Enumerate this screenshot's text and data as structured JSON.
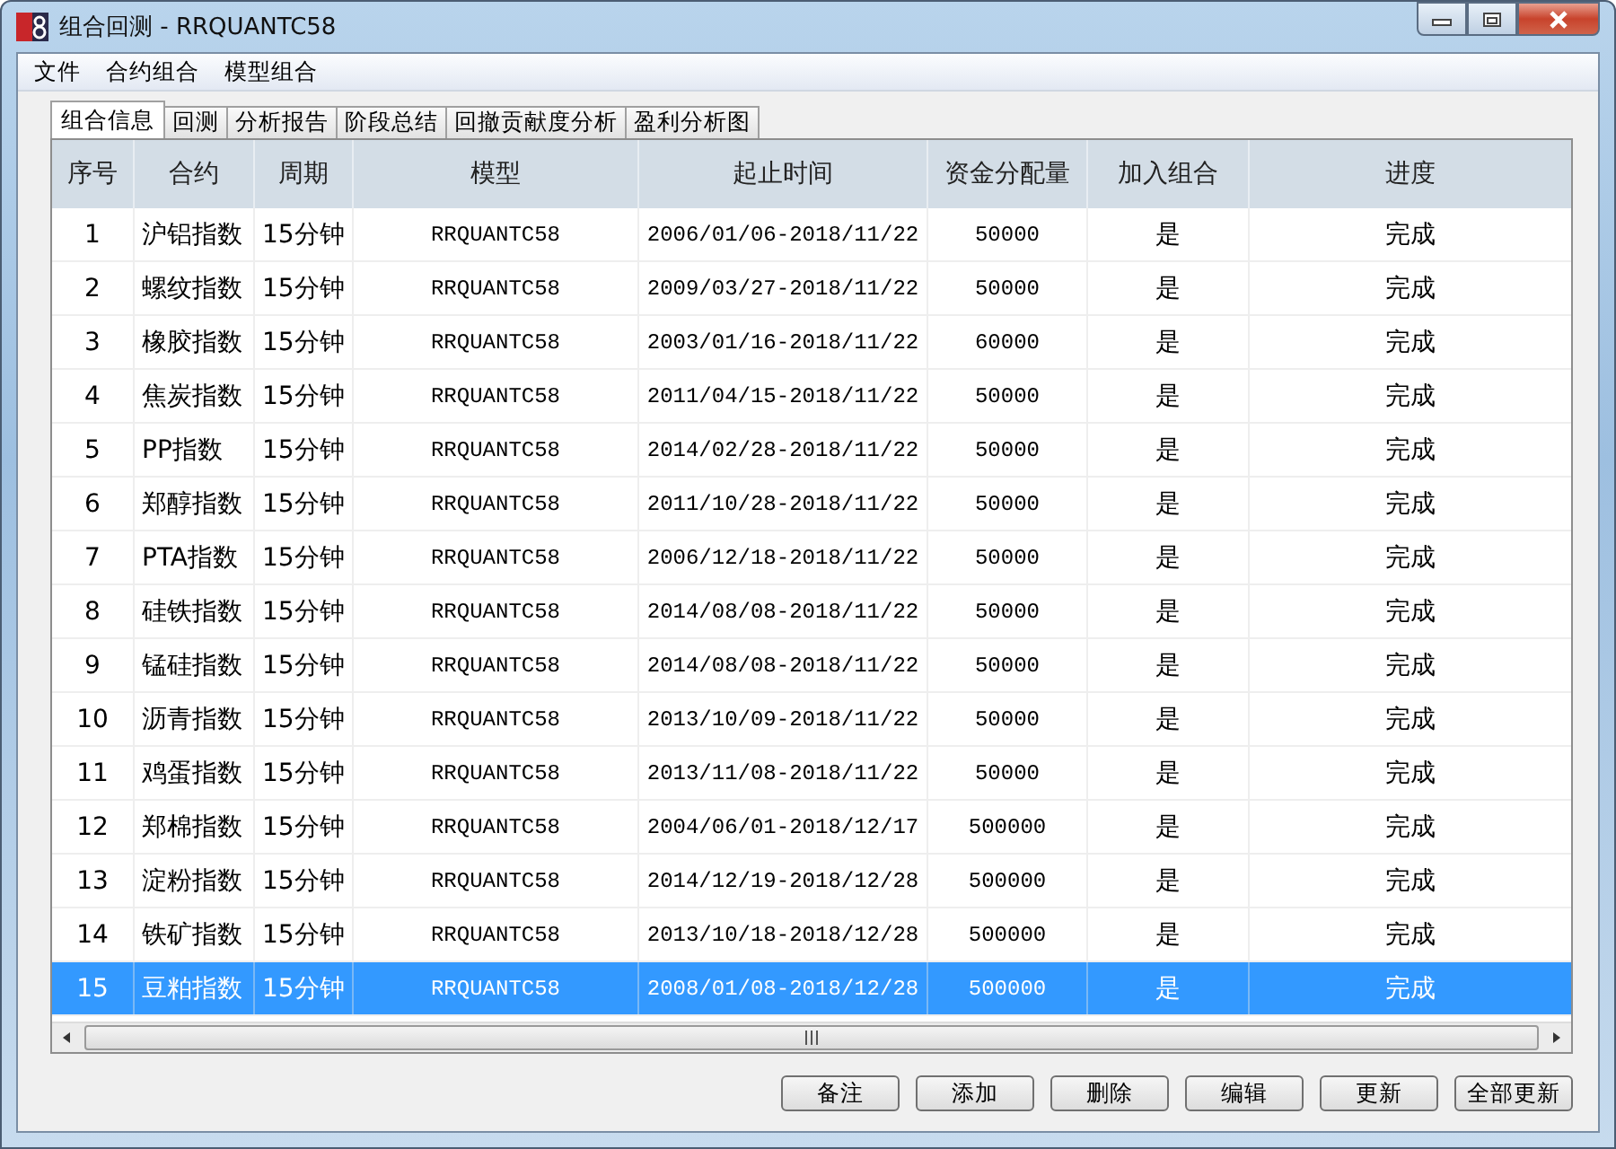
{
  "window": {
    "title": "组合回测 - RRQUANTC58"
  },
  "menu": [
    "文件",
    "合约组合",
    "模型组合"
  ],
  "tabs": [
    {
      "label": "组合信息",
      "selected": true
    },
    {
      "label": "回测",
      "selected": false
    },
    {
      "label": "分析报告",
      "selected": false
    },
    {
      "label": "阶段总结",
      "selected": false
    },
    {
      "label": "回撤贡献度分析",
      "selected": false
    },
    {
      "label": "盈利分析图",
      "selected": false
    }
  ],
  "table": {
    "columns": [
      "序号",
      "合约",
      "周期",
      "模型",
      "起止时间",
      "资金分配量",
      "加入组合",
      "进度"
    ],
    "rows": [
      {
        "cells": [
          "1",
          "沪铝指数",
          "15分钟",
          "RRQUANTC58",
          "2006/01/06-2018/11/22",
          "50000",
          "是",
          "完成"
        ],
        "selected": false
      },
      {
        "cells": [
          "2",
          "螺纹指数",
          "15分钟",
          "RRQUANTC58",
          "2009/03/27-2018/11/22",
          "50000",
          "是",
          "完成"
        ],
        "selected": false
      },
      {
        "cells": [
          "3",
          "橡胶指数",
          "15分钟",
          "RRQUANTC58",
          "2003/01/16-2018/11/22",
          "60000",
          "是",
          "完成"
        ],
        "selected": false
      },
      {
        "cells": [
          "4",
          "焦炭指数",
          "15分钟",
          "RRQUANTC58",
          "2011/04/15-2018/11/22",
          "50000",
          "是",
          "完成"
        ],
        "selected": false
      },
      {
        "cells": [
          "5",
          "PP指数",
          "15分钟",
          "RRQUANTC58",
          "2014/02/28-2018/11/22",
          "50000",
          "是",
          "完成"
        ],
        "selected": false
      },
      {
        "cells": [
          "6",
          "郑醇指数",
          "15分钟",
          "RRQUANTC58",
          "2011/10/28-2018/11/22",
          "50000",
          "是",
          "完成"
        ],
        "selected": false
      },
      {
        "cells": [
          "7",
          "PTA指数",
          "15分钟",
          "RRQUANTC58",
          "2006/12/18-2018/11/22",
          "50000",
          "是",
          "完成"
        ],
        "selected": false
      },
      {
        "cells": [
          "8",
          "硅铁指数",
          "15分钟",
          "RRQUANTC58",
          "2014/08/08-2018/11/22",
          "50000",
          "是",
          "完成"
        ],
        "selected": false
      },
      {
        "cells": [
          "9",
          "锰硅指数",
          "15分钟",
          "RRQUANTC58",
          "2014/08/08-2018/11/22",
          "50000",
          "是",
          "完成"
        ],
        "selected": false
      },
      {
        "cells": [
          "10",
          "沥青指数",
          "15分钟",
          "RRQUANTC58",
          "2013/10/09-2018/11/22",
          "50000",
          "是",
          "完成"
        ],
        "selected": false
      },
      {
        "cells": [
          "11",
          "鸡蛋指数",
          "15分钟",
          "RRQUANTC58",
          "2013/11/08-2018/11/22",
          "50000",
          "是",
          "完成"
        ],
        "selected": false
      },
      {
        "cells": [
          "12",
          "郑棉指数",
          "15分钟",
          "RRQUANTC58",
          "2004/06/01-2018/12/17",
          "500000",
          "是",
          "完成"
        ],
        "selected": false
      },
      {
        "cells": [
          "13",
          "淀粉指数",
          "15分钟",
          "RRQUANTC58",
          "2014/12/19-2018/12/28",
          "500000",
          "是",
          "完成"
        ],
        "selected": false
      },
      {
        "cells": [
          "14",
          "铁矿指数",
          "15分钟",
          "RRQUANTC58",
          "2013/10/18-2018/12/28",
          "500000",
          "是",
          "完成"
        ],
        "selected": false
      },
      {
        "cells": [
          "15",
          "豆粕指数",
          "15分钟",
          "RRQUANTC58",
          "2008/01/08-2018/12/28",
          "500000",
          "是",
          "完成"
        ],
        "selected": true
      }
    ]
  },
  "buttons": [
    "备注",
    "添加",
    "删除",
    "编辑",
    "更新",
    "全部更新"
  ]
}
